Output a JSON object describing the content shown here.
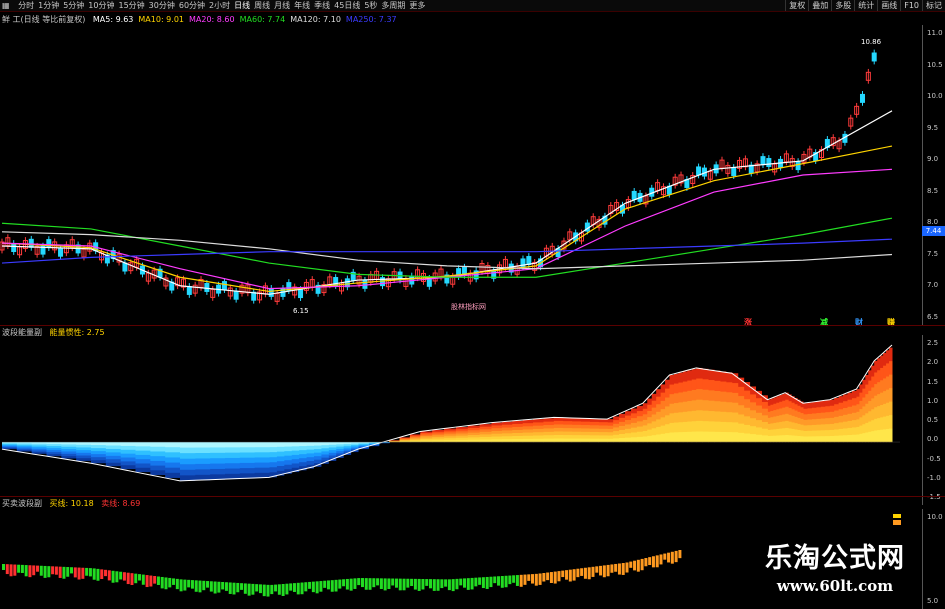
{
  "toolbar": {
    "icon": "grid-icon",
    "periods": [
      "分时",
      "1分钟",
      "5分钟",
      "10分钟",
      "15分钟",
      "30分钟",
      "60分钟",
      "2小时",
      "日线",
      "周线",
      "月线",
      "年线",
      "季线",
      "45日线",
      "5秒",
      "多周期",
      "更多"
    ],
    "active_period": "日线",
    "right": [
      "复权",
      "叠加",
      "多股",
      "统计",
      "画线",
      "F10",
      "标记"
    ]
  },
  "main_legend": {
    "title": "鲜 工(日线 等比前复权)",
    "ma": [
      {
        "label": "MA5: 9.63",
        "color": "#ffffff"
      },
      {
        "label": "MA10: 9.01",
        "color": "#ffd400"
      },
      {
        "label": "MA20: 8.60",
        "color": "#ff3cff"
      },
      {
        "label": "MA60: 7.74",
        "color": "#22dd22"
      },
      {
        "label": "MA120: 7.10",
        "color": "#dddddd"
      },
      {
        "label": "MA250: 7.37",
        "color": "#3b3bff"
      }
    ]
  },
  "main_axis": [
    "11.0",
    "10.5",
    "10.0",
    "9.5",
    "9.0",
    "8.5",
    "8.0",
    "7.5",
    "7.0",
    "6.5"
  ],
  "labels": {
    "peak": "10.86",
    "low": "6.15",
    "center": "股林指标网",
    "last_price": "7.44"
  },
  "signals": [
    {
      "text": "涨",
      "color": "#ff3333"
    },
    {
      "text": "减",
      "color": "#33ff33"
    },
    {
      "text": "财",
      "color": "#3399ff"
    },
    {
      "text": "赚",
      "color": "#ffd400"
    }
  ],
  "panel2": {
    "legend": "波段能量副",
    "sub": "能量惯性: 2.75",
    "axis": [
      "2.5",
      "2.0",
      "1.5",
      "1.0",
      "0.5",
      "0.0",
      "-0.5",
      "-1.0",
      "-1.5"
    ]
  },
  "panel3": {
    "legend": "买卖波段副",
    "buy": "买线: 10.18",
    "sell": "卖线: 8.69",
    "axis": [
      "10.0",
      "5.0"
    ]
  },
  "watermark": {
    "title": "乐淘公式网",
    "url": "www.60lt.com"
  },
  "chart_data": [
    {
      "type": "line",
      "title": "鲜 工(日线 等比前复权)",
      "ylim": [
        6.0,
        11.0
      ],
      "x": [
        0,
        10,
        20,
        30,
        40,
        50,
        60,
        70,
        80,
        90,
        100
      ],
      "series": [
        {
          "name": "MA5",
          "color": "#ffffff",
          "values": [
            7.25,
            7.2,
            6.55,
            6.4,
            6.65,
            6.7,
            6.95,
            8.0,
            8.6,
            8.75,
            9.63
          ]
        },
        {
          "name": "MA10",
          "color": "#ffd400",
          "values": [
            7.3,
            7.22,
            6.7,
            6.45,
            6.6,
            6.72,
            6.9,
            7.9,
            8.4,
            8.7,
            9.01
          ]
        },
        {
          "name": "MA20",
          "color": "#ff3cff",
          "values": [
            7.3,
            7.25,
            6.85,
            6.5,
            6.55,
            6.7,
            6.85,
            7.6,
            8.2,
            8.5,
            8.6
          ]
        },
        {
          "name": "MA60",
          "color": "#22dd22",
          "values": [
            7.65,
            7.55,
            7.25,
            6.95,
            6.75,
            6.7,
            6.7,
            6.95,
            7.2,
            7.45,
            7.74
          ]
        },
        {
          "name": "MA120",
          "color": "#dddddd",
          "values": [
            7.5,
            7.45,
            7.35,
            7.2,
            7.0,
            6.9,
            6.85,
            6.9,
            6.95,
            7.0,
            7.1
          ]
        },
        {
          "name": "MA250",
          "color": "#3b3bff",
          "values": [
            6.95,
            7.05,
            7.1,
            7.15,
            7.15,
            7.15,
            7.15,
            7.2,
            7.25,
            7.3,
            7.37
          ]
        }
      ]
    },
    {
      "type": "area",
      "title": "波段能量副",
      "ylim": [
        -1.5,
        2.75
      ],
      "x": [
        0,
        10,
        20,
        30,
        35,
        40,
        47,
        55,
        62,
        68,
        72,
        75,
        78,
        82,
        86,
        88,
        90,
        93,
        96,
        98,
        100
      ],
      "series": [
        {
          "name": "能量惯性",
          "values": [
            -0.2,
            -0.6,
            -1.1,
            -1.0,
            -0.7,
            -0.2,
            0.3,
            0.55,
            0.7,
            0.65,
            1.1,
            1.9,
            2.1,
            1.95,
            1.2,
            1.4,
            1.1,
            1.2,
            1.5,
            2.3,
            2.75
          ]
        }
      ]
    },
    {
      "type": "bar",
      "title": "买卖波段副",
      "ylim": [
        5.0,
        10.0
      ],
      "x": [
        0,
        10,
        20,
        30,
        40,
        50,
        60,
        70,
        76
      ],
      "series": [
        {
          "name": "买线",
          "values": [
            7.5,
            7.2,
            6.4,
            6.0,
            6.5,
            6.4,
            6.8,
            7.6,
            8.5
          ]
        }
      ]
    }
  ]
}
